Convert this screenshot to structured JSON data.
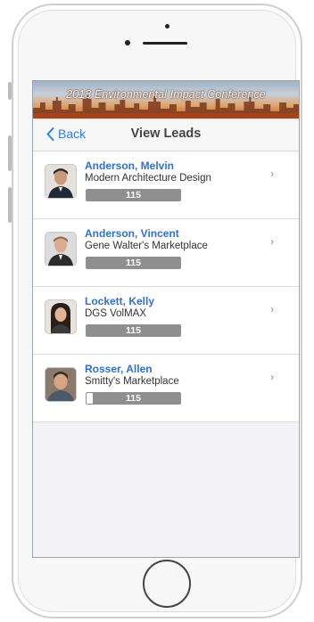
{
  "banner": {
    "title": "2018 Environmental Impact Conference"
  },
  "nav": {
    "back_label": "Back",
    "title": "View Leads"
  },
  "leads": [
    {
      "name": "Anderson, Melvin",
      "company": "Modern Architecture Design",
      "score": "115",
      "progress": 0
    },
    {
      "name": "Anderson, Vincent",
      "company": "Gene Walter's Marketplace",
      "score": "115",
      "progress": 0
    },
    {
      "name": "Lockett, Kelly",
      "company": "DGS VolMAX",
      "score": "115",
      "progress": 0
    },
    {
      "name": "Rosser, Allen",
      "company": "Smitty's Marketplace",
      "score": "115",
      "progress": 0.07
    }
  ],
  "chevron_glyph": "›",
  "colors": {
    "link": "#2e7cf6",
    "name": "#2e6fd8",
    "score_bar": "#8f8f8f"
  }
}
